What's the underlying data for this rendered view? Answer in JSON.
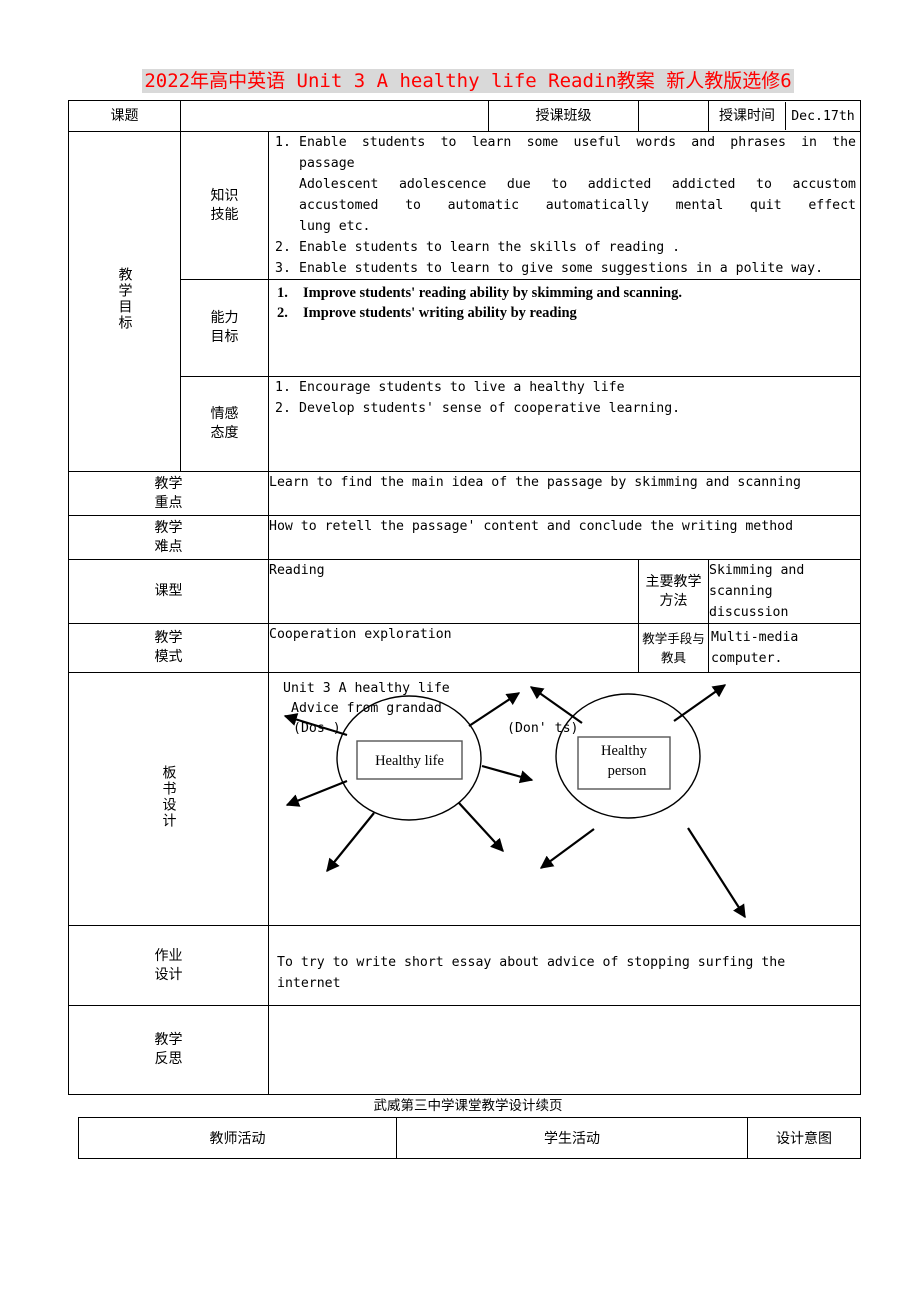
{
  "document": {
    "title": "2022年高中英语 Unit 3 A healthy life Readin教案 新人教版选修6",
    "title_color": "#ff0000",
    "title_highlight": "#d9d9d9",
    "footer_caption": "武威第三中学课堂教学设计续页"
  },
  "header_row": {
    "topic_label": "课题",
    "topic_value": "",
    "class_label": "授课班级",
    "class_value": "",
    "time_label": "授课时间",
    "time_value": "Dec.17th"
  },
  "objectives": {
    "row_label": "教学目标",
    "knowledge": {
      "label": "知识技能",
      "items": [
        {
          "num": "1.",
          "lines": [
            "Enable students to learn some useful words and phrases in the",
            "passage",
            "Adolescent  adolescence  due to  addicted  addicted to accustom",
            "accustomed to  automatic  automatically  mental  quit  effect",
            "lung etc."
          ]
        },
        {
          "num": "2.",
          "lines": [
            "Enable students to learn the skills of reading ."
          ]
        },
        {
          "num": "3.",
          "lines": [
            "Enable students to learn to give some suggestions  in a polite way."
          ]
        }
      ]
    },
    "ability": {
      "label": "能力目标",
      "items": [
        {
          "num": "1.",
          "text": "Improve  students' reading  ability  by  skimming and scanning."
        },
        {
          "num": "2.",
          "text": "Improve  students' writing  ability  by  reading"
        }
      ]
    },
    "emotion": {
      "label": "情感态度",
      "items": [
        {
          "num": "1.",
          "text": "Encourage students to live a healthy life"
        },
        {
          "num": "2.",
          "text": "Develop students'  sense of cooperative learning."
        }
      ]
    }
  },
  "key_point": {
    "label": "教学重点",
    "value": "Learn to find the  main idea of the passage by skimming and scanning"
  },
  "difficult_point": {
    "label": "教学难点",
    "value": "How to retell the passage'  content and conclude the writing method"
  },
  "lesson_type": {
    "label": "课型",
    "value": "Reading",
    "method_label": "主要教学方法",
    "method_value_line1": "Skimming and scanning",
    "method_value_line2": "discussion"
  },
  "teaching_mode": {
    "label": "教学模式",
    "value": "Cooperation   exploration",
    "aids_label": "教学手段与教具",
    "aids_value": "Multi-media computer."
  },
  "blackboard": {
    "label": "板书设计",
    "heading_line1": "Unit 3 A healthy life",
    "heading_line2": "Advice from grandad",
    "dos_label": "(Dos )",
    "donts_label": "(Don' ts)",
    "node_left_line1": "Healthy life",
    "node_right_line1": "Healthy",
    "node_right_line2": "person"
  },
  "homework": {
    "label": "作业设计",
    "value": "To   try  to  write  short essay about advice of stopping surfing the internet"
  },
  "reflection": {
    "label": "教学反思",
    "value": ""
  },
  "continuation_table": {
    "columns": [
      "教师活动",
      "学生活动",
      "设计意图"
    ]
  }
}
